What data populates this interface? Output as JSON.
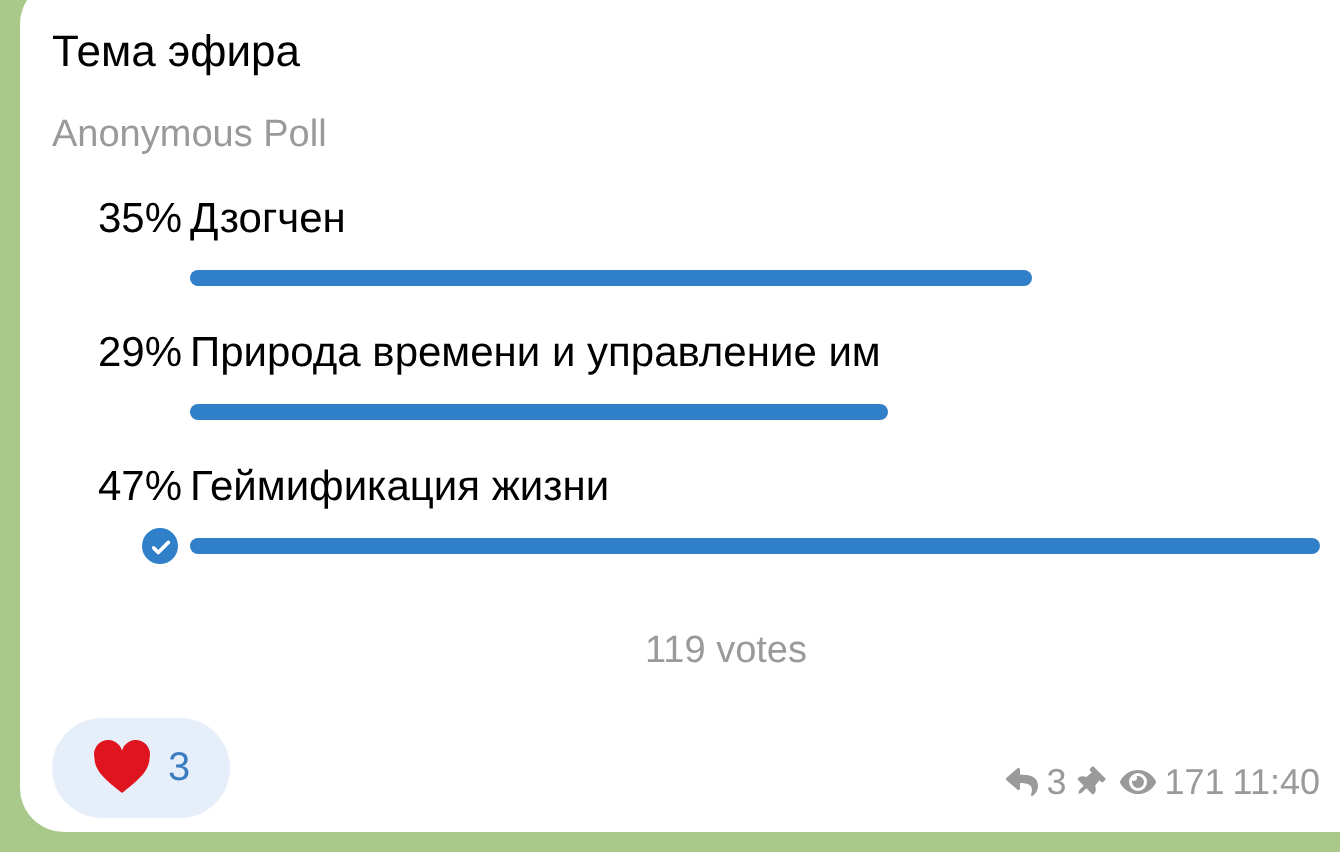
{
  "poll": {
    "question": "Тема эфира",
    "type_label": "Anonymous Poll",
    "options": [
      {
        "percent": "35%",
        "text": "Дзогчен",
        "selected": false
      },
      {
        "percent": "29%",
        "text": "Природа времени и управление им",
        "selected": false
      },
      {
        "percent": "47%",
        "text": "Геймификация жизни",
        "selected": true
      }
    ],
    "votes": "119 votes"
  },
  "reaction": {
    "count": "3"
  },
  "meta": {
    "replies": "3",
    "pinned": true,
    "views": "171",
    "time": "11:40"
  }
}
